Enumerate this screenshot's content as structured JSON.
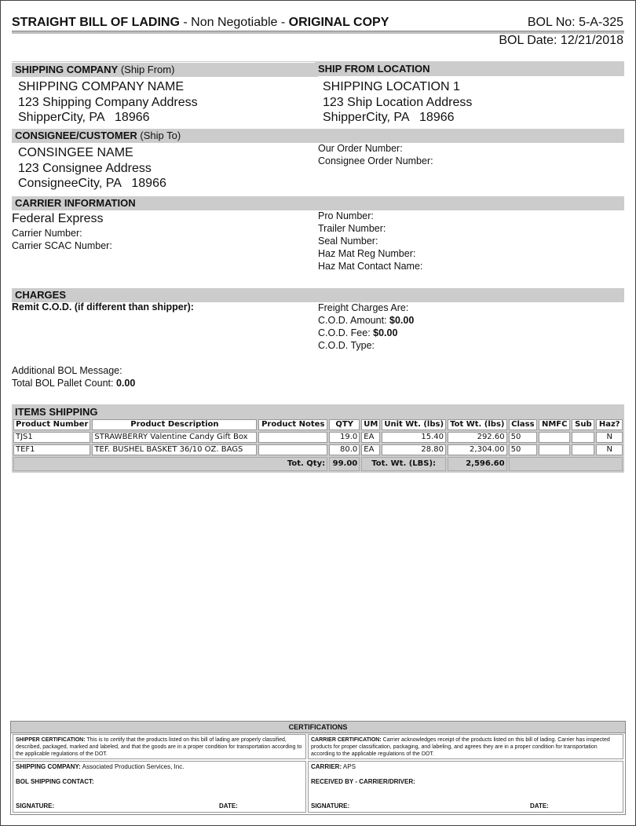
{
  "header": {
    "title_part1": "STRAIGHT BILL OF LADING",
    "title_sep1": " - ",
    "title_part2": "Non Negotiable",
    "title_sep2": " - ",
    "title_part3": "ORIGINAL COPY",
    "bol_no": "BOL No: 5-A-325",
    "bol_date": "BOL Date: 12/21/2018"
  },
  "shipping_company": {
    "heading": "SHIPPING COMPANY",
    "heading_note": " (Ship From)",
    "name": "SHIPPING COMPANY NAME",
    "address": "123 Shipping Company Address",
    "city": "ShipperCity, PA   18966"
  },
  "ship_from_location": {
    "heading": "SHIP FROM LOCATION",
    "name": "SHIPPING LOCATION 1",
    "address": "123 Ship Location Address",
    "city": "ShipperCity, PA   18966"
  },
  "consignee": {
    "heading": "CONSIGNEE/CUSTOMER",
    "heading_note": " (Ship To)",
    "name": "CONSINGEE NAME",
    "address": "123 Consignee Address",
    "city": "ConsigneeCity, PA   18966",
    "our_order_number": "Our Order Number:",
    "consignee_order_number": "Consignee Order Number:"
  },
  "carrier": {
    "heading": "CARRIER INFORMATION",
    "name": "Federal Express",
    "carrier_number": "Carrier Number:",
    "carrier_scac": "Carrier SCAC Number:",
    "pro_number": "Pro Number:",
    "trailer_number": "Trailer Number:",
    "seal_number": "Seal Number:",
    "haz_mat_reg": "Haz Mat Reg Number:",
    "haz_mat_contact": "Haz Mat Contact Name:"
  },
  "charges": {
    "heading": "CHARGES",
    "remit_cod": "Remit C.O.D. (if different than shipper):",
    "freight_charges": "Freight Charges Are:",
    "cod_amount_label": "C.O.D. Amount: ",
    "cod_amount": "$0.00",
    "cod_fee_label": "C.O.D. Fee: ",
    "cod_fee": "$0.00",
    "cod_type": "C.O.D. Type:",
    "additional_message": "Additional BOL Message:",
    "pallet_count_label": "Total BOL Pallet Count: ",
    "pallet_count": "0.00"
  },
  "items": {
    "heading": "ITEMS SHIPPING",
    "columns": [
      "Product Number",
      "Product Description",
      "Product Notes",
      "QTY",
      "UM",
      "Unit Wt. (lbs)",
      "Tot Wt. (lbs)",
      "Class",
      "NMFC",
      "Sub",
      "Haz?"
    ],
    "rows": [
      [
        "TJS1",
        "STRAWBERRY Valentine Candy Gift Box",
        "",
        "19.0",
        "EA",
        "15.40",
        "292.60",
        "50",
        "",
        "",
        "N"
      ],
      [
        "TEF1",
        "TEF. BUSHEL BASKET 36/10 OZ. BAGS",
        "",
        "80.0",
        "EA",
        "28.80",
        "2,304.00",
        "50",
        "",
        "",
        "N"
      ]
    ],
    "tot_qty_label": "Tot. Qty:",
    "tot_qty": "99.00",
    "tot_wt_label": "Tot. Wt. (LBS):",
    "tot_wt": "2,596.60"
  },
  "certifications": {
    "heading": "CERTIFICATIONS",
    "shipper_cert_label": "SHIPPER CERTIFICATION:",
    "shipper_cert_text": " This is to certify that the products listed on this bill of lading are properly classified, described, packaged, marked and labeled, and that the goods are in a proper condition for transportation according to the applicable regulations of the DOT.",
    "carrier_cert_label": "CARRIER CERTIFICATION:",
    "carrier_cert_text": " Carrier acknowledges receipt of the products listed on this bill of lading. Carrier has inspected products for proper classification, packaging, and labeling, and agrees they are in a proper condition for transportation according to the applicable regulations of the DOT.",
    "shipping_company_label": "SHIPPING COMPANY:",
    "shipping_company_value": " Associated Production Services, Inc.",
    "bol_contact_label": "BOL SHIPPING CONTACT:",
    "carrier_label": "CARRIER:",
    "carrier_value": " APS",
    "received_by_label": "RECEIVED BY - CARRIER/DRIVER:",
    "signature_label": "SIGNATURE:",
    "date_label": "DATE:"
  }
}
